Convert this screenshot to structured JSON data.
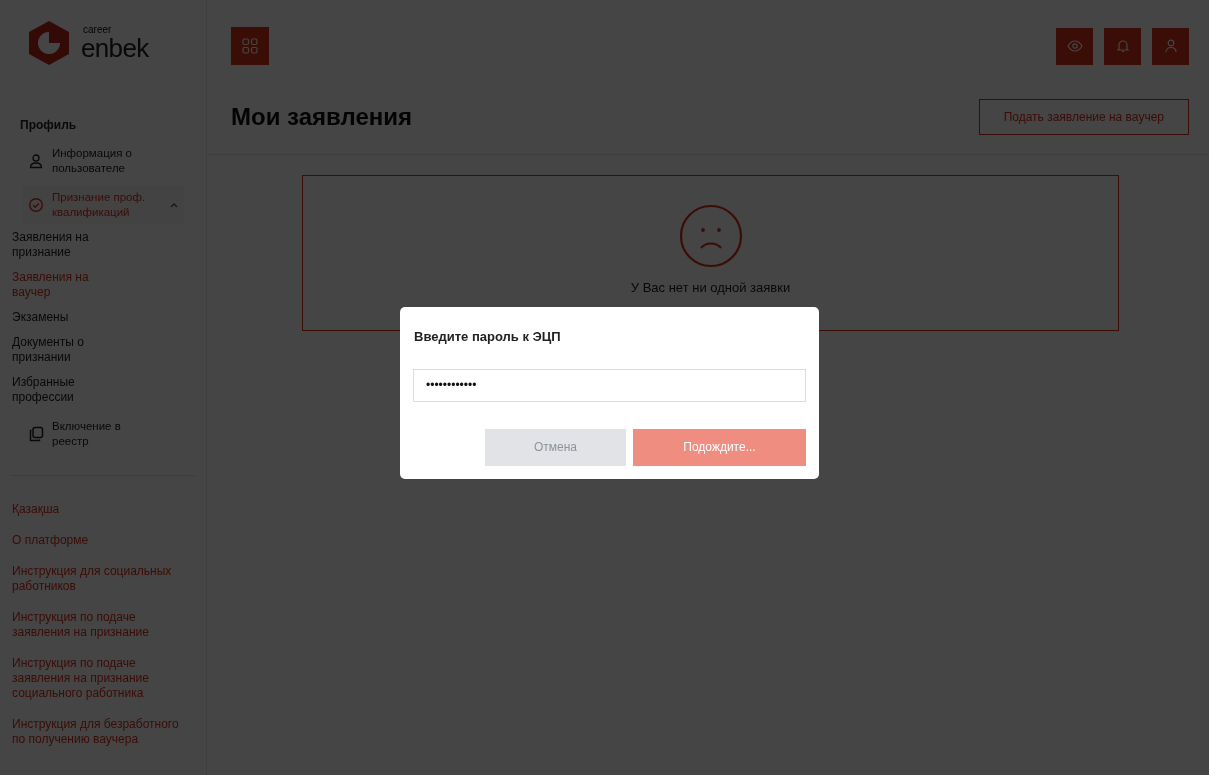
{
  "logo": {
    "small": "career",
    "main": "enbek"
  },
  "sidebar": {
    "section": "Профиль",
    "items": [
      {
        "kind": "person",
        "label": "Информация о пользователе",
        "selected": false
      },
      {
        "kind": "group",
        "label": "Признание проф. квалификаций",
        "selected": true,
        "expanded": true,
        "children": [
          {
            "label": "Заявления на признание",
            "selected": false
          },
          {
            "label": "Заявления на ваучер",
            "selected": true
          },
          {
            "label": "Экзамены",
            "selected": false
          },
          {
            "label": "Документы о признании",
            "selected": false
          },
          {
            "label": "Избранные профессии",
            "selected": false
          }
        ]
      },
      {
        "kind": "register",
        "label": "Включение в реестр",
        "selected": false
      }
    ],
    "links": [
      "Қазақша",
      "О платформе",
      "Инструкция для социальных работников",
      "Инструкция по подаче заявления на признание",
      "Инструкция по подаче заявления на признание социального работника",
      "Инструкция для безработного по получению ваучера"
    ]
  },
  "page": {
    "title": "Мои заявления",
    "action": "Подать заявление на ваучер",
    "empty_text": "У Вас нет ни одной заявки"
  },
  "modal": {
    "title": "Введите пароль к ЭЦП",
    "value": "••••••••••••",
    "buttons": [
      {
        "kind": "cancel",
        "label": "Отмена",
        "disabled": true
      },
      {
        "kind": "submit",
        "label": "Подождите...",
        "disabled": true
      }
    ]
  }
}
